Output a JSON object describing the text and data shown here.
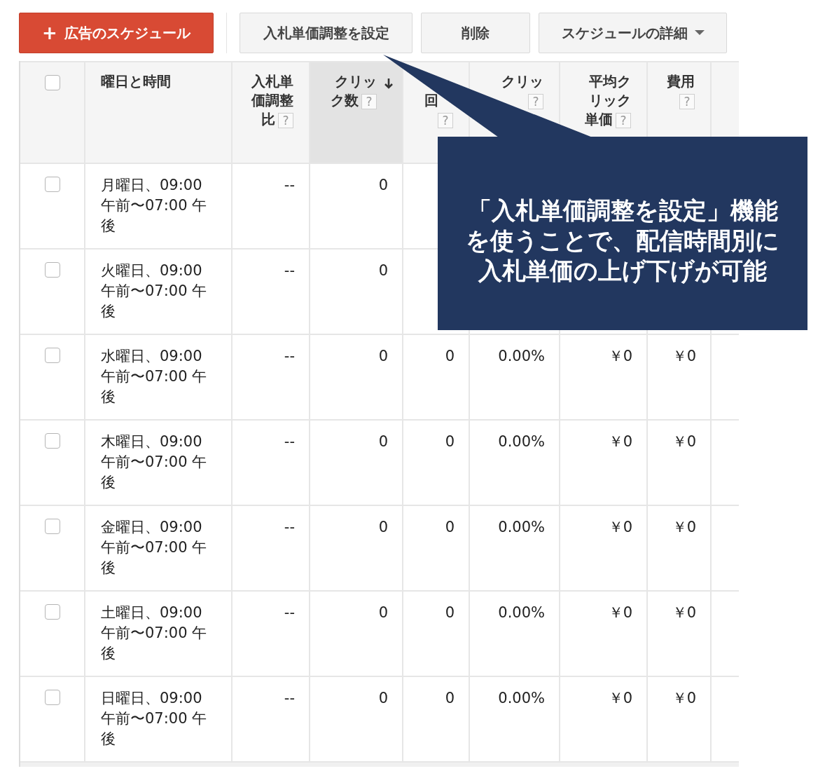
{
  "toolbar": {
    "primary_button": {
      "icon": "+",
      "label": "広告のスケジュール"
    },
    "buttons": [
      {
        "label": "入札単価調整を設定",
        "dropdown": false
      },
      {
        "label": "削除",
        "dropdown": false
      },
      {
        "label": "スケジュールの詳細",
        "dropdown": true
      }
    ]
  },
  "table": {
    "select_all": {
      "checked": false
    },
    "columns": [
      {
        "label": "曜日と時間",
        "sorted": false
      },
      {
        "label": "入札単価調整比",
        "sorted": false,
        "help": "?"
      },
      {
        "label": "クリック数",
        "sorted": true,
        "help": "?"
      },
      {
        "label": "回",
        "sorted": false,
        "help": "?"
      },
      {
        "label": "クリッ",
        "sorted": false,
        "help": "?"
      },
      {
        "label": "平均クリック単価",
        "sorted": false,
        "help": "?"
      },
      {
        "label": "費用",
        "sorted": false,
        "help": "?"
      }
    ],
    "rows": [
      {
        "checked": false,
        "cells": [
          "月曜日、09:00 午前〜07:00 午後",
          "--",
          "0"
        ]
      },
      {
        "checked": false,
        "cells": [
          "火曜日、09:00 午前〜07:00 午後",
          "--",
          "0"
        ]
      },
      {
        "checked": false,
        "cells": [
          "水曜日、09:00 午前〜07:00 午後",
          "--",
          "0",
          "0",
          "0.00%",
          "￥0",
          "￥0"
        ]
      },
      {
        "checked": false,
        "cells": [
          "木曜日、09:00 午前〜07:00 午後",
          "--",
          "0",
          "0",
          "0.00%",
          "￥0",
          "￥0"
        ]
      },
      {
        "checked": false,
        "cells": [
          "金曜日、09:00 午前〜07:00 午後",
          "--",
          "0",
          "0",
          "0.00%",
          "￥0",
          "￥0"
        ]
      },
      {
        "checked": false,
        "cells": [
          "土曜日、09:00 午前〜07:00 午後",
          "--",
          "0",
          "0",
          "0.00%",
          "￥0",
          "￥0"
        ]
      },
      {
        "checked": false,
        "cells": [
          "日曜日、09:00 午前〜07:00 午後",
          "--",
          "0",
          "0",
          "0.00%",
          "￥0",
          "￥0"
        ]
      }
    ]
  },
  "callout": {
    "text": "「入札単価調整を設定」機能を使うことで、配信時間別に入札単価の上げ下げが可能"
  }
}
